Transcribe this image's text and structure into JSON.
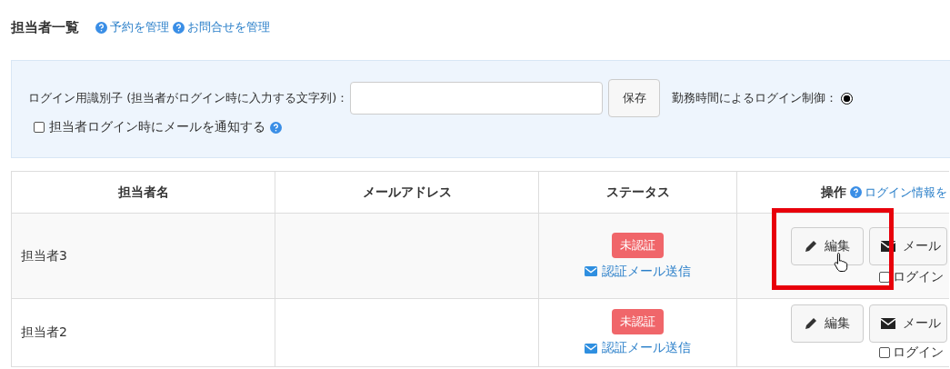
{
  "page_title": "担当者一覧",
  "help_links": [
    {
      "label": "予約を管理"
    },
    {
      "label": "お問合せを管理"
    }
  ],
  "settings": {
    "identifier_label": "ログイン用識別子 (担当者がログイン時に入力する文字列)：",
    "save_button": "保存",
    "work_hours_label": "勤務時間によるログイン制御：",
    "work_hours_radio_selected": true,
    "notify_label": "担当者ログイン時にメールを通知する",
    "notify_checked": false
  },
  "table": {
    "columns": [
      "担当者名",
      "メールアドレス",
      "ステータス",
      "操作"
    ],
    "header_link": "ログイン情報を",
    "rows": [
      {
        "name": "担当者3",
        "status": "未認証",
        "resend_link": "認証メール送信",
        "edit_button": "編集",
        "mail_button": "メール",
        "login_label": "ログイン",
        "login_checked": false,
        "highlighted": true
      },
      {
        "name": "担当者2",
        "status": "未認証",
        "resend_link": "認証メール送信",
        "edit_button": "編集",
        "mail_button": "メール",
        "login_label": "ログイン",
        "login_checked": false,
        "highlighted": false
      }
    ]
  }
}
